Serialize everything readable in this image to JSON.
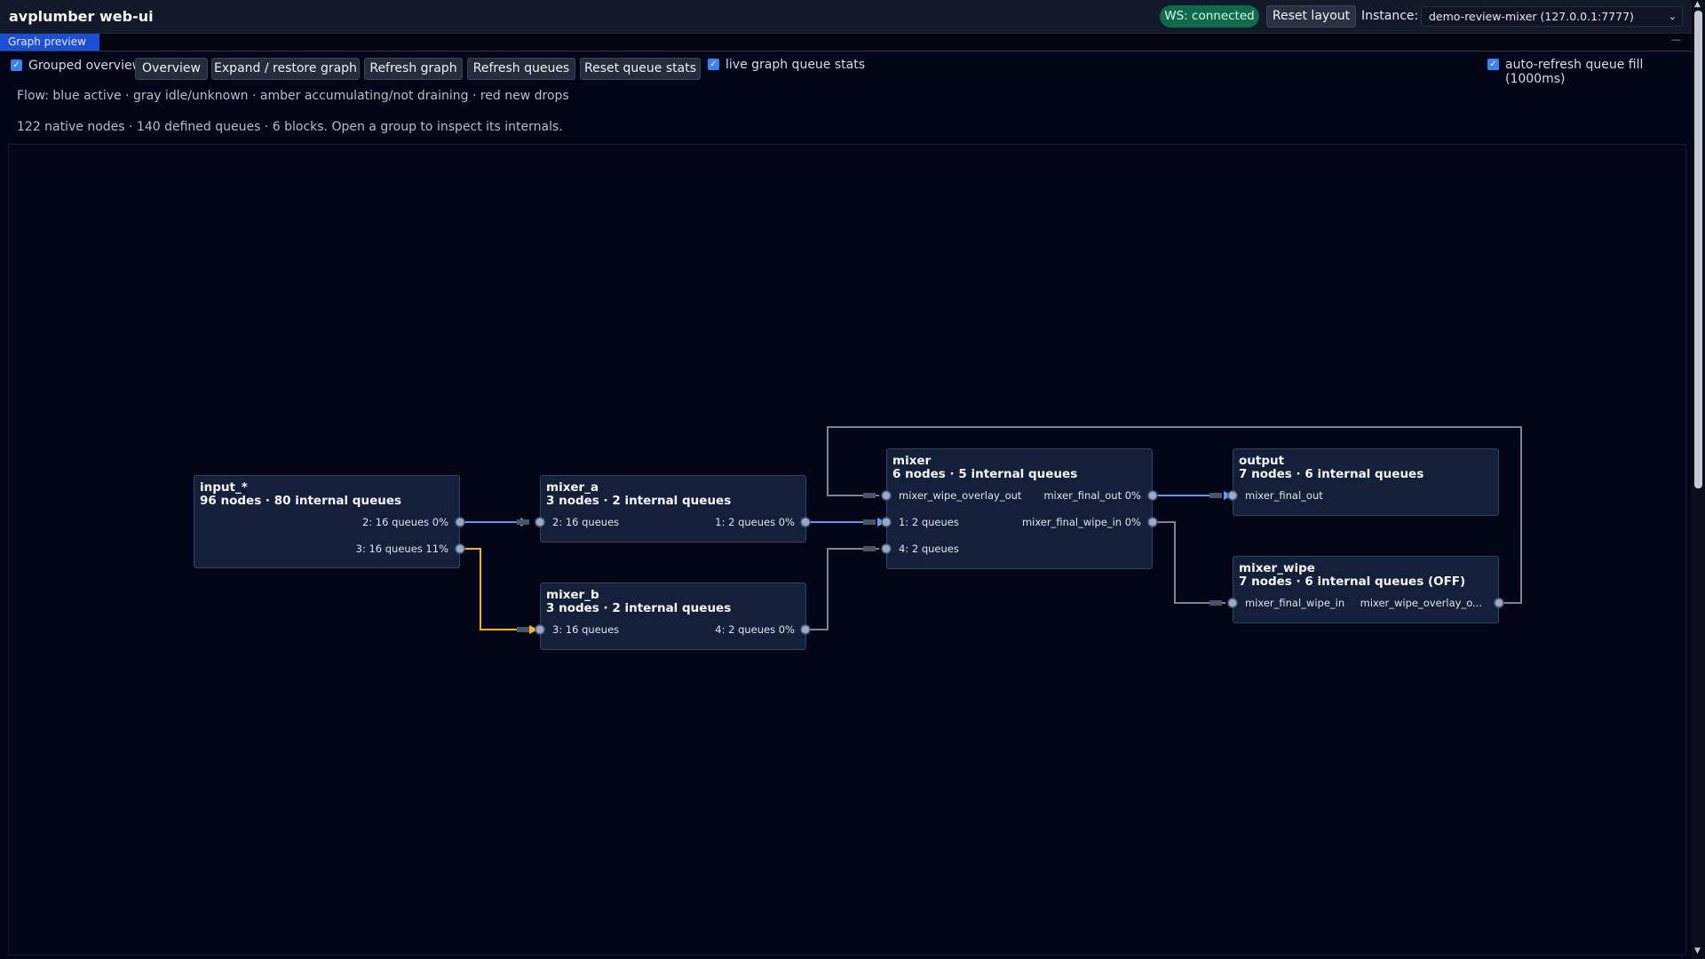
{
  "header": {
    "title": "avplumber web-ui",
    "ws_status": "WS: connected",
    "reset_layout": "Reset layout",
    "instance_label": "Instance:",
    "instance_value": "demo-review-mixer (127.0.0.1:7777)"
  },
  "tabs": {
    "active": "Graph preview",
    "minimize": "—"
  },
  "controls": {
    "grouped_overview": {
      "label": "Grouped overview",
      "checked": true
    },
    "overview_btn": "Overview",
    "expand_btn": "Expand / restore graph",
    "refresh_graph_btn": "Refresh graph",
    "refresh_queues_btn": "Refresh queues",
    "reset_stats_btn": "Reset queue stats",
    "live_stats": {
      "label": "live graph queue stats",
      "checked": true
    },
    "auto_refresh": {
      "label": "auto-refresh queue fill (1000ms)",
      "checked": true
    }
  },
  "info": {
    "flow_legend": "Flow: blue active · gray idle/unknown · amber accumulating/not draining · red new drops",
    "summary": "122 native nodes · 140 defined queues  · 6 blocks. Open a group to inspect its internals."
  },
  "graph": {
    "colors": {
      "active": "#3b82f6",
      "idle": "#6b7280",
      "accumulating": "#f5b614",
      "drops": "#ef4444"
    },
    "nodes": {
      "input": {
        "title": "input_*",
        "subtitle": "96 nodes · 80 internal queues",
        "out1": "2: 16 queues 0%",
        "out2": "3: 16 queues 11%"
      },
      "mixer_a": {
        "title": "mixer_a",
        "subtitle": "3 nodes · 2 internal queues",
        "in1": "2: 16 queues",
        "out1": "1: 2 queues 0%"
      },
      "mixer_b": {
        "title": "mixer_b",
        "subtitle": "3 nodes · 2 internal queues",
        "in1": "3: 16 queues",
        "out1": "4: 2 queues 0%"
      },
      "mixer": {
        "title": "mixer",
        "subtitle": "6 nodes · 5 internal queues",
        "in1": "mixer_wipe_overlay_out",
        "in2": "1: 2 queues",
        "in3": "4: 2 queues",
        "out1": "mixer_final_out 0%",
        "out2": "mixer_final_wipe_in 0%"
      },
      "output": {
        "title": "output",
        "subtitle": "7 nodes · 6 internal queues",
        "in1": "mixer_final_out"
      },
      "mixer_wipe": {
        "title": "mixer_wipe",
        "subtitle": "7 nodes · 6 internal queues (OFF)",
        "in1": "mixer_final_wipe_in",
        "out1": "mixer_wipe_overlay_o..."
      }
    },
    "edges": [
      {
        "from": "input_*",
        "to": "mixer_a",
        "queue": "2",
        "state": "active"
      },
      {
        "from": "input_*",
        "to": "mixer_b",
        "queue": "3",
        "state": "accumulating"
      },
      {
        "from": "mixer_a",
        "to": "mixer",
        "queue": "1",
        "state": "active"
      },
      {
        "from": "mixer_b",
        "to": "mixer",
        "queue": "4",
        "state": "idle"
      },
      {
        "from": "mixer",
        "to": "output",
        "queue": "mixer_final_out",
        "state": "active"
      },
      {
        "from": "mixer",
        "to": "mixer_wipe",
        "queue": "mixer_final_wipe_in",
        "state": "idle"
      },
      {
        "from": "mixer_wipe",
        "to": "mixer",
        "queue": "mixer_wipe_overlay_out",
        "state": "idle"
      }
    ]
  }
}
